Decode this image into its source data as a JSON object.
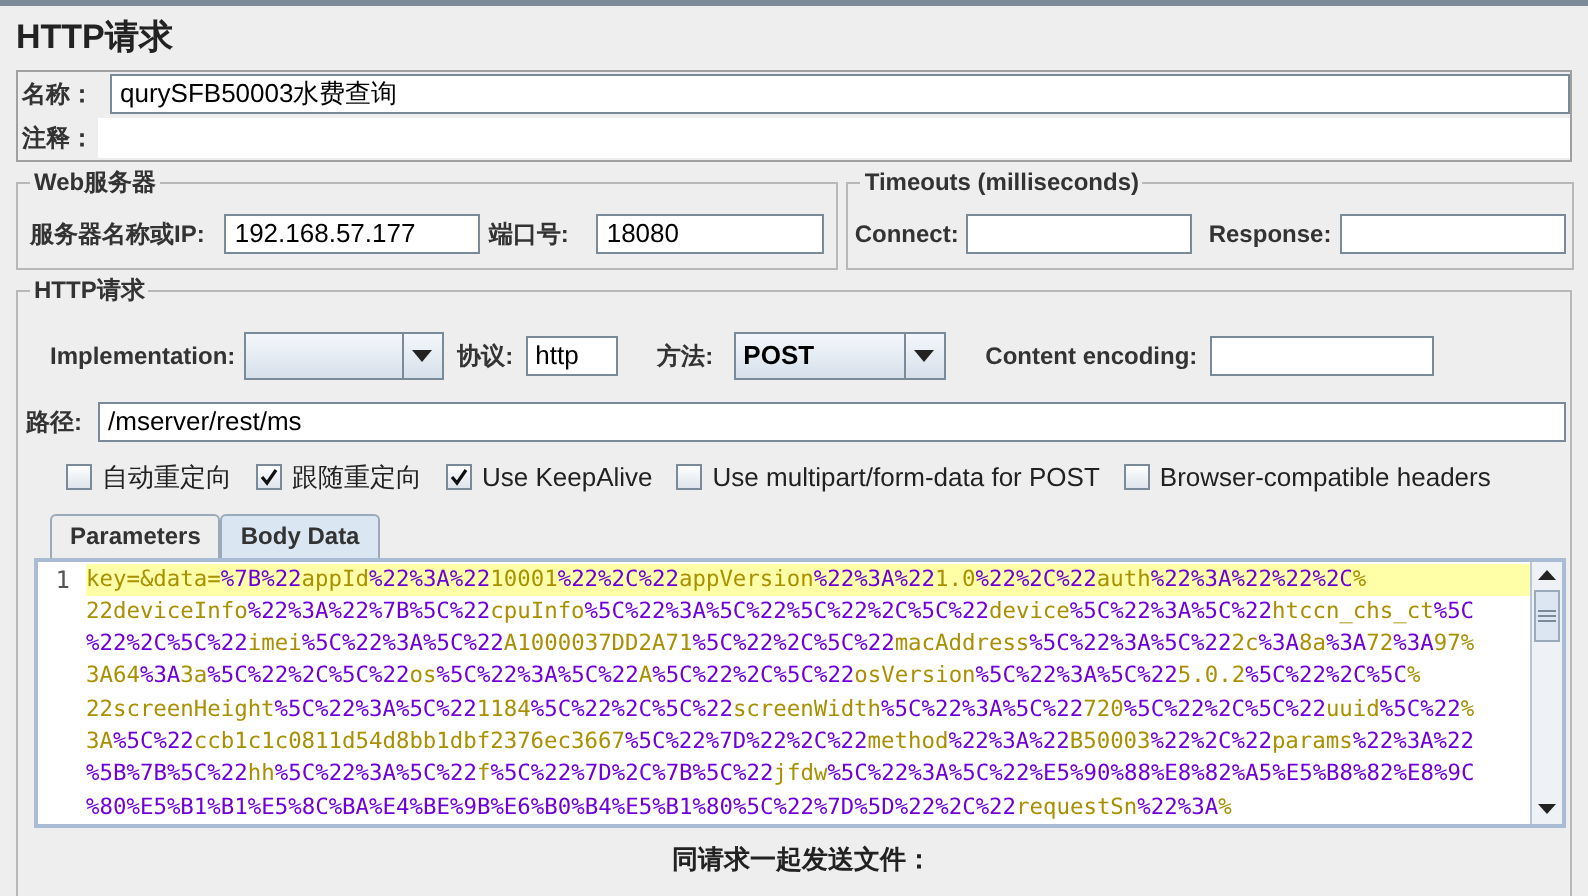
{
  "title": "HTTP请求",
  "name_field": {
    "label": "名称：",
    "value": "qurySFB50003水费查询"
  },
  "comments_field": {
    "label": "注释："
  },
  "web_server": {
    "legend": "Web服务器",
    "server_label": "服务器名称或IP:",
    "server_value": "192.168.57.177",
    "port_label": "端口号:",
    "port_value": "18080"
  },
  "timeouts": {
    "legend": "Timeouts (milliseconds)",
    "connect_label": "Connect:",
    "response_label": "Response:"
  },
  "http_request": {
    "legend": "HTTP请求",
    "implementation_label": "Implementation:",
    "protocol_label": "协议:",
    "protocol_value": "http",
    "method_label": "方法:",
    "method_value": "POST",
    "encoding_label": "Content encoding:",
    "path_label": "路径:",
    "path_value": "/mserver/rest/ms",
    "options": [
      {
        "label": "自动重定向",
        "checked": false
      },
      {
        "label": "跟随重定向",
        "checked": true
      },
      {
        "label": "Use KeepAlive",
        "checked": true
      },
      {
        "label": "Use multipart/form-data for POST",
        "checked": false
      },
      {
        "label": "Browser-compatible headers",
        "checked": false
      }
    ],
    "tabs": [
      {
        "label": "Parameters",
        "selected": false
      },
      {
        "label": "Body Data",
        "selected": true
      }
    ],
    "body": {
      "line_number": "1",
      "lines": [
        "key=&data=%7B%22appId%22%3A%2210001%22%2C%22appVersion%22%3A%221.0%22%2C%22auth%22%3A%22%22%2C%",
        "22deviceInfo%22%3A%22%7B%5C%22cpuInfo%5C%22%3A%5C%22%5C%22%2C%5C%22device%5C%22%3A%5C%22htccn_chs_ct%5C",
        "%22%2C%5C%22imei%5C%22%3A%5C%22A1000037DD2A71%5C%22%2C%5C%22macAddress%5C%22%3A%5C%222c%3A8a%3A72%3A97%",
        "3A64%3A3a%5C%22%2C%5C%22os%5C%22%3A%5C%22A%5C%22%2C%5C%22osVersion%5C%22%3A%5C%225.0.2%5C%22%2C%5C%",
        "22screenHeight%5C%22%3A%5C%221184%5C%22%2C%5C%22screenWidth%5C%22%3A%5C%22720%5C%22%2C%5C%22uuid%5C%22%",
        "3A%5C%22ccb1c1c0811d54d8bb1dbf2376ec3667%5C%22%7D%22%2C%22method%22%3A%22B50003%22%2C%22params%22%3A%22",
        "%5B%7B%5C%22hh%5C%22%3A%5C%22f%5C%22%7D%2C%7B%5C%22jfdw%5C%22%3A%5C%22%E5%90%88%E8%82%A5%E5%B8%82%E8%9C",
        "%80%E5%B1%B1%E5%8C%BA%E4%BE%9B%E6%B0%B4%E5%B1%80%5C%22%7D%5D%22%2C%22requestSn%22%3A%"
      ]
    },
    "files_label": "同请求一起发送文件："
  }
}
